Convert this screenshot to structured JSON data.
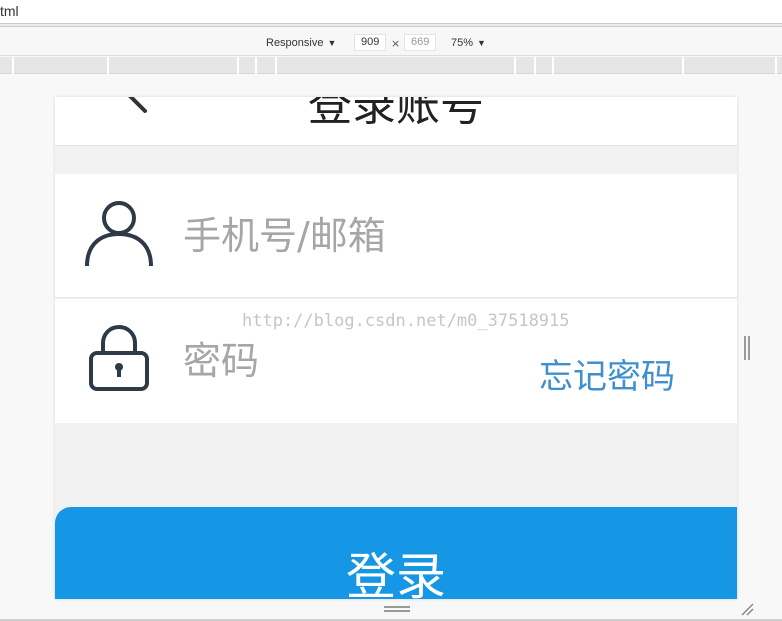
{
  "browser": {
    "url_fragment": "tml"
  },
  "device_toolbar": {
    "mode": "Responsive",
    "mode_caret": "▼",
    "width": "909",
    "separator": "×",
    "height": "669",
    "zoom": "75%",
    "zoom_caret": "▼"
  },
  "page": {
    "title": "登录账号",
    "username": {
      "placeholder": "手机号/邮箱",
      "icon": "user-icon"
    },
    "password": {
      "placeholder": "密码",
      "icon": "lock-icon"
    },
    "forgot_password": "忘记密码",
    "login_button": "登录",
    "watermark": "http://blog.csdn.net/m0_37518915"
  },
  "colors": {
    "accent": "#1597e5",
    "link": "#3d8fce",
    "placeholder": "#a6a6a6"
  }
}
